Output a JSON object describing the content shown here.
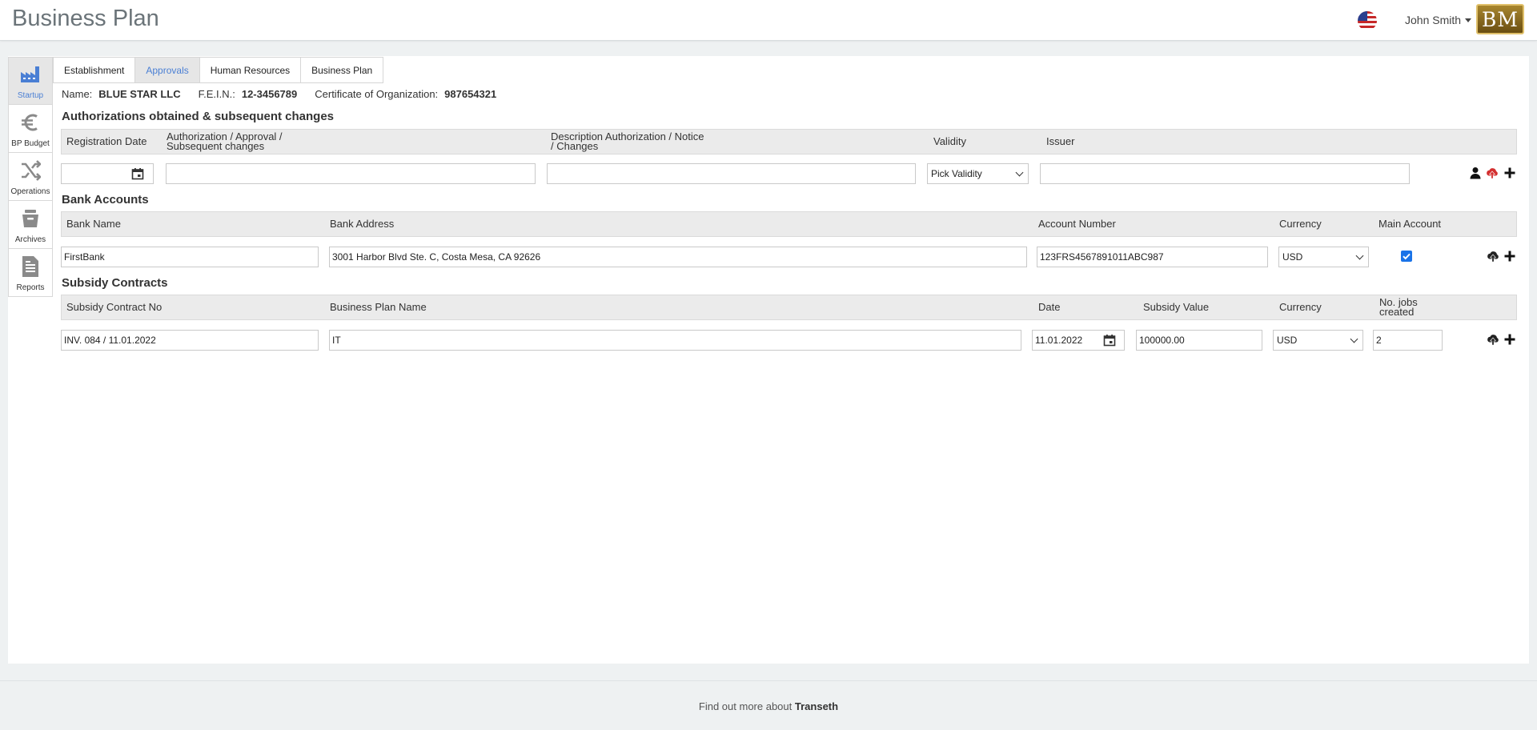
{
  "header": {
    "title": "Business Plan",
    "user_name": "John Smith",
    "logo_text": "BM",
    "flag_icon": "us-flag-icon"
  },
  "side_nav": [
    {
      "label": "Startup",
      "icon": "factory-icon",
      "active": true
    },
    {
      "label": "BP Budget",
      "icon": "euro-icon",
      "active": false
    },
    {
      "label": "Operations",
      "icon": "shuffle-icon",
      "active": false
    },
    {
      "label": "Archives",
      "icon": "archive-box-icon",
      "active": false
    },
    {
      "label": "Reports",
      "icon": "report-document-icon",
      "active": false
    }
  ],
  "tabs": [
    {
      "label": "Establishment",
      "active": false
    },
    {
      "label": "Approvals",
      "active": true
    },
    {
      "label": "Human Resources",
      "active": false
    },
    {
      "label": "Business Plan",
      "active": false
    }
  ],
  "company": {
    "name_label": "Name:",
    "name": "BLUE STAR LLC",
    "fein_label": "F.E.I.N.:",
    "fein": "12-3456789",
    "cert_label": "Certificate of Organization:",
    "cert": "987654321"
  },
  "authorizations": {
    "title": "Authorizations obtained & subsequent changes",
    "headers": {
      "registration_date": "Registration Date",
      "authorization_line1": "Authorization / Approval /",
      "authorization_line2": "Subsequent changes",
      "description_line1": "Description Authorization / Notice",
      "description_line2": "/ Changes",
      "validity": "Validity",
      "issuer": "Issuer"
    },
    "row": {
      "registration_date": "",
      "authorization": "",
      "description": "",
      "validity": "Pick Validity",
      "issuer": ""
    }
  },
  "bank_accounts": {
    "title": "Bank Accounts",
    "headers": {
      "bank_name": "Bank Name",
      "bank_address": "Bank Address",
      "account_number": "Account Number",
      "currency": "Currency",
      "main_account": "Main Account"
    },
    "row": {
      "bank_name": "FirstBank",
      "bank_address": "3001 Harbor Blvd Ste. C, Costa Mesa, CA 92626",
      "account_number": "123FRS4567891011ABC987",
      "currency": "USD",
      "main_account": true
    }
  },
  "subsidy_contracts": {
    "title": "Subsidy Contracts",
    "headers": {
      "contract_no": "Subsidy Contract No",
      "business_plan_name": "Business Plan Name",
      "date": "Date",
      "subsidy_value": "Subsidy Value",
      "currency": "Currency",
      "jobs_line1": "No. jobs",
      "jobs_line2": "created"
    },
    "row": {
      "contract_no": "INV. 084 / 11.01.2022",
      "business_plan_name": "IT",
      "date": "11.01.2022",
      "subsidy_value": "100000.00",
      "currency": "USD",
      "jobs_created": "2"
    }
  },
  "footer": {
    "text": "Find out more about",
    "brand": "Transeth"
  },
  "colors": {
    "accent": "#4a7fd4",
    "upload_red": "#d32f2f",
    "checkbox_blue": "#1a73e8"
  }
}
